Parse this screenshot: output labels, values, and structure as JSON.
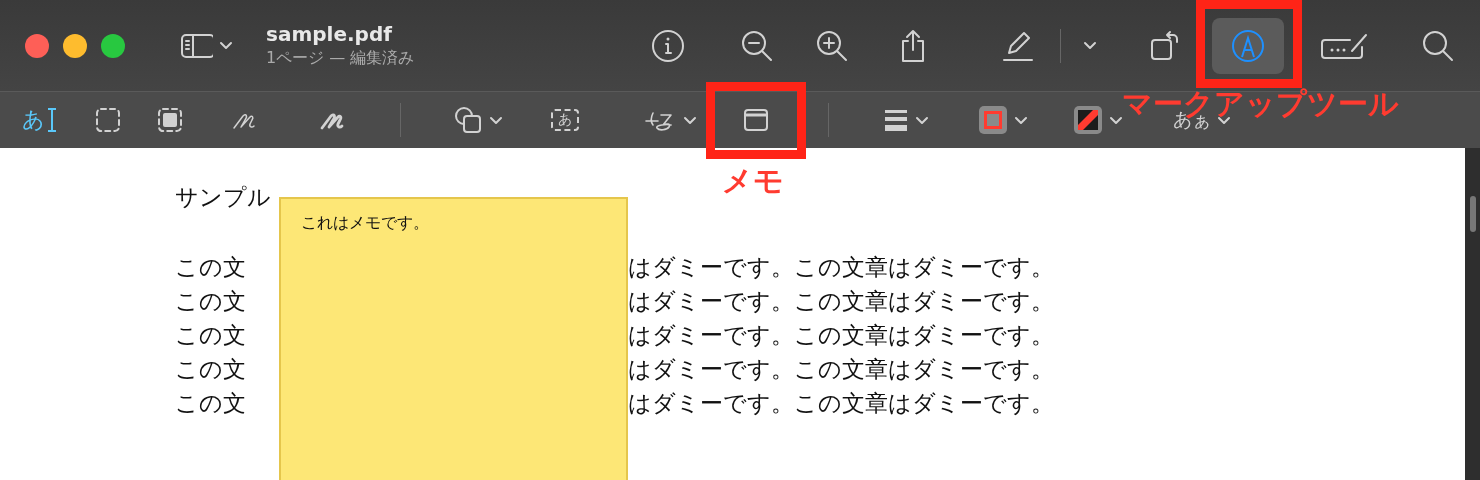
{
  "window": {
    "title": "sample.pdf",
    "subtitle": "1ページ — 編集済み"
  },
  "toolbar": [
    {
      "kind": "sidebar",
      "selected": false
    },
    {
      "kind": "info",
      "selected": false
    },
    {
      "kind": "zoom_out",
      "selected": false
    },
    {
      "kind": "zoom_in",
      "selected": false
    },
    {
      "kind": "share",
      "selected": false
    },
    {
      "kind": "highlight",
      "selected": false
    },
    {
      "kind": "divider"
    },
    {
      "kind": "menu",
      "selected": false
    },
    {
      "kind": "rotate",
      "selected": false
    },
    {
      "kind": "markup",
      "selected": true
    },
    {
      "kind": "form",
      "selected": false
    },
    {
      "kind": "search",
      "selected": false
    }
  ],
  "markup_toolbar": [
    {
      "kind": "text",
      "label": "あ"
    },
    {
      "kind": "select_rect"
    },
    {
      "kind": "select_smart"
    },
    {
      "kind": "sketch"
    },
    {
      "kind": "draw"
    },
    {
      "kind": "divider"
    },
    {
      "kind": "shapes"
    },
    {
      "kind": "textbox",
      "label": "あ"
    },
    {
      "kind": "sign"
    },
    {
      "kind": "note"
    },
    {
      "kind": "divider"
    },
    {
      "kind": "line_style"
    },
    {
      "kind": "border_color",
      "color": "#ff3b30"
    },
    {
      "kind": "fill_color",
      "color": "#ff3b30"
    },
    {
      "kind": "font",
      "label": "あぁ"
    }
  ],
  "document": {
    "title": "サンプル",
    "lines": [
      {
        "left": "この文",
        "right": "はダミーです。この文章はダミーです。"
      },
      {
        "left": "この文",
        "right": "はダミーです。この文章はダミーです。"
      },
      {
        "left": "この文",
        "right": "はダミーです。この文章はダミーです。"
      },
      {
        "left": "この文",
        "right": "はダミーです。この文章はダミーです。"
      },
      {
        "left": "この文",
        "right": "はダミーです。この文章はダミーです。"
      }
    ],
    "note": {
      "text": "これはメモです。"
    }
  },
  "annotations": [
    {
      "label": "マークアップツール"
    },
    {
      "label": "メモ"
    }
  ]
}
